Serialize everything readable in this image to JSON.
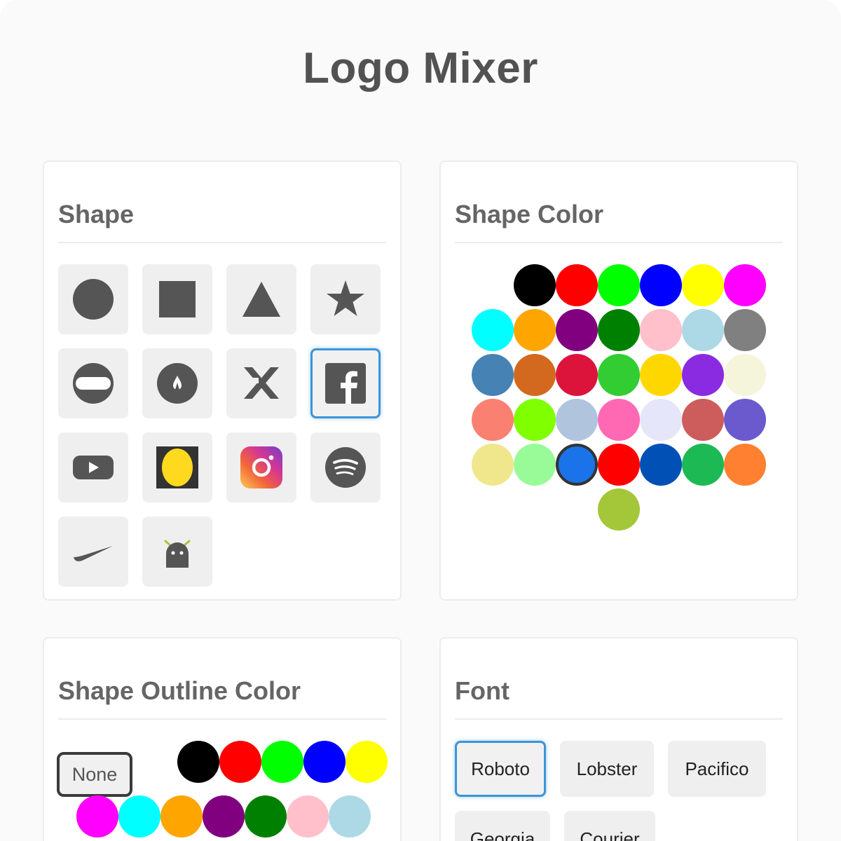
{
  "app": {
    "title": "Logo Mixer"
  },
  "shape_panel": {
    "title": "Shape",
    "shapes": [
      {
        "name": "circle"
      },
      {
        "name": "square"
      },
      {
        "name": "triangle"
      },
      {
        "name": "star"
      },
      {
        "name": "ring"
      },
      {
        "name": "drop-badge"
      },
      {
        "name": "cross-x"
      },
      {
        "name": "facebook",
        "selected": true
      },
      {
        "name": "youtube"
      },
      {
        "name": "snapchat-square"
      },
      {
        "name": "instagram"
      },
      {
        "name": "spotify"
      },
      {
        "name": "swoosh"
      },
      {
        "name": "ghost"
      }
    ]
  },
  "shape_color_panel": {
    "title": "Shape Color",
    "selected": "#1a73e8",
    "colors": [
      "#000000",
      "#ff0000",
      "#00ff00",
      "#0000ff",
      "#ffff00",
      "#ff00ff",
      "#00ffff",
      "#ffa500",
      "#800080",
      "#008000",
      "#ffc0cb",
      "#add8e6",
      "#808080",
      "#4682b4",
      "#d2691e",
      "#dc143c",
      "#32cd32",
      "#ffd700",
      "#8a2be2",
      "#f5f5dc",
      "#fa8072",
      "#7fff00",
      "#b0c4de",
      "#ff69b4",
      "#e6e6fa",
      "#cd5c5c",
      "#6a5acd",
      "#f0e68c",
      "#98fb98",
      "#1a73e8",
      "#ff0000",
      "#0050b5",
      "#1db954",
      "#ff8030",
      "#a4c639"
    ]
  },
  "outline_color_panel": {
    "title": "Shape Outline Color",
    "none_label": "None",
    "colors": [
      "#000000",
      "#ff0000",
      "#00ff00",
      "#0000ff",
      "#ffff00",
      "#ff00ff",
      "#00ffff",
      "#ffa500",
      "#800080",
      "#008000",
      "#ffc0cb",
      "#add8e6"
    ]
  },
  "font_panel": {
    "title": "Font",
    "fonts": [
      {
        "label": "Roboto",
        "selected": true
      },
      {
        "label": "Lobster"
      },
      {
        "label": "Pacifico"
      },
      {
        "label": "Georgia"
      },
      {
        "label": "Courier"
      }
    ]
  }
}
